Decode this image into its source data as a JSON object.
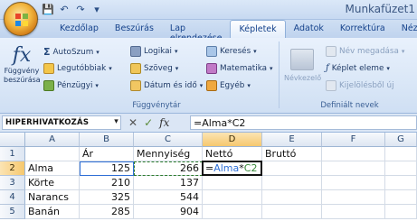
{
  "title": "Munkafüzet1",
  "quick_access": [
    "save-icon",
    "undo-icon",
    "redo-icon",
    "customize-icon"
  ],
  "tabs": [
    "Kezdőlap",
    "Beszúrás",
    "Lap elrendezése",
    "Képletek",
    "Adatok",
    "Korrektúra",
    "Nézet"
  ],
  "active_tab": "Képletek",
  "ribbon": {
    "insert_function": "Függvény beszúrása",
    "library": {
      "autosum": "AutoSzum",
      "recent": "Legutóbbiak",
      "financial": "Pénzügyi",
      "logical": "Logikai",
      "text": "Szöveg",
      "datetime": "Dátum és idő",
      "lookup": "Keresés",
      "math": "Matematika",
      "more": "Egyéb",
      "group_label": "Függvénytár"
    },
    "names": {
      "name_manager": "Névkezelő",
      "define_name": "Név megadása",
      "use_in_formula": "Képlet eleme",
      "create_from_selection": "Kijelölésből új",
      "group_label": "Definiált nevek"
    }
  },
  "formula_bar": {
    "name_box": "HIPERHIVATKOZÁS",
    "formula": "=Alma*C2"
  },
  "grid": {
    "columns": [
      "A",
      "B",
      "C",
      "D",
      "E",
      "F",
      "G"
    ],
    "rows": [
      {
        "num": "1",
        "cells": [
          "",
          "Ár",
          "Mennyiség",
          "Nettó",
          "Bruttó",
          "",
          ""
        ]
      },
      {
        "num": "2",
        "cells": [
          "Alma",
          "125",
          "266",
          "=Alma*C2",
          "",
          "",
          ""
        ]
      },
      {
        "num": "3",
        "cells": [
          "Körte",
          "210",
          "137",
          "",
          "",
          "",
          ""
        ]
      },
      {
        "num": "4",
        "cells": [
          "Narancs",
          "325",
          "544",
          "",
          "",
          "",
          ""
        ]
      },
      {
        "num": "5",
        "cells": [
          "Banán",
          "285",
          "904",
          "",
          "",
          "",
          ""
        ]
      }
    ],
    "edit_formula_parts": {
      "eq": "=",
      "name_ref": "Alma",
      "op": "*",
      "cell_ref": "C2"
    }
  }
}
